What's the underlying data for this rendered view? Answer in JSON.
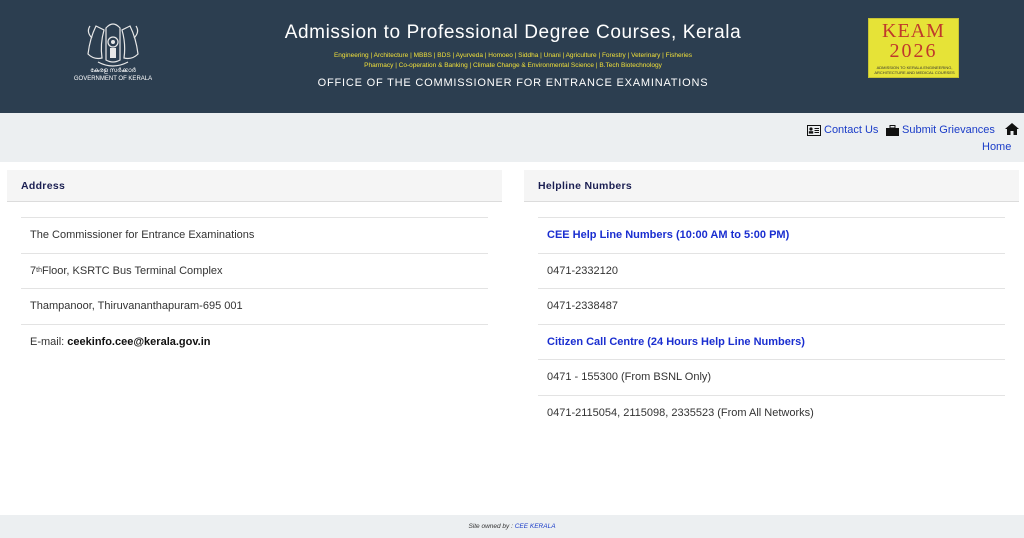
{
  "header": {
    "emblem_text_line1": "കേരള സർക്കാർ",
    "emblem_text_line2": "GOVERNMENT OF KERALA",
    "title": "Admission to Professional Degree Courses, Kerala",
    "courses_line1": "Engineering | Architecture | MBBS | BDS | Ayurveda | Homoeo | Siddha | Unani | Agriculture | Forestry | Veterinary | Fisheries",
    "courses_line2": "Pharmacy | Co-operation & Banking | Climate Change & Environmental Science | B.Tech Biotechnology",
    "office": "OFFICE OF THE COMMISSIONER FOR ENTRANCE EXAMINATIONS",
    "keam_logo": {
      "title": "KEAM",
      "year": "2026",
      "subtitle": "ADMISSION TO KERALA ENGINEERING, ARCHITECTURE AND MEDICAL COURSES"
    }
  },
  "nav": {
    "contact_label": "Contact Us",
    "grievance_label": "Submit Grievances",
    "home_label": "Home"
  },
  "address": {
    "heading": "Address",
    "line1": "The Commissioner for Entrance Examinations",
    "line2_prefix": "7",
    "line2_sup": "th",
    "line2_rest": " Floor, KSRTC Bus Terminal Complex",
    "line3": "Thampanoor, Thiruvananthapuram-695 001",
    "email_label": "E-mail: ",
    "email_value": "ceekinfo.cee@kerala.gov.in"
  },
  "helpline": {
    "heading": "Helpline Numbers",
    "cee_title": "CEE Help Line Numbers (10:00 AM to 5:00 PM)",
    "cee_phone1": "0471-2332120",
    "cee_phone2": "0471-2338487",
    "citizen_title": "Citizen Call Centre (24 Hours Help Line Numbers)",
    "citizen_phone1": "0471 - 155300 (From BSNL Only)",
    "citizen_phone2": "0471-2115054, 2115098, 2335523 (From All Networks)"
  },
  "footer": {
    "owned_by": "Site owned by : ",
    "owner_link": "CEE KERALA"
  },
  "colors": {
    "header_bg": "#2c3e50",
    "link": "#1a2ed0",
    "courses_text": "#f1e03a",
    "keam_bg": "#e6e337",
    "keam_text": "#c0392b"
  },
  "icons": {
    "emblem": "kerala-emblem-icon",
    "contact": "address-card-icon",
    "grievance": "briefcase-icon",
    "home": "home-icon"
  }
}
